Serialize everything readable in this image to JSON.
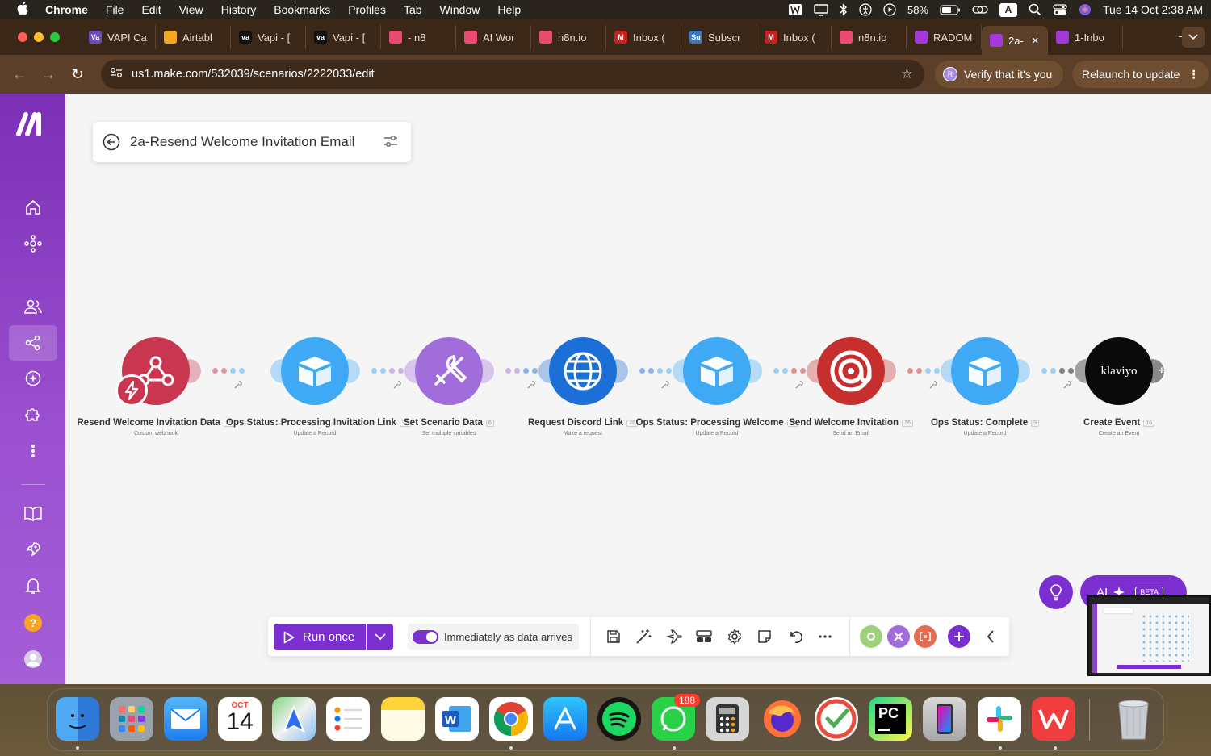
{
  "menubar": {
    "app": "Chrome",
    "items": [
      "File",
      "Edit",
      "View",
      "History",
      "Bookmarks",
      "Profiles",
      "Tab",
      "Window",
      "Help"
    ],
    "battery": "58%",
    "input_source": "A",
    "clock": "Tue 14 Oct  2:38 AM"
  },
  "tabs": [
    {
      "label": "VAPI Ca",
      "fav": "Va",
      "color": "#6b4ab6"
    },
    {
      "label": "Airtabl",
      "fav": "",
      "color": "#f5a623"
    },
    {
      "label": "Vapi - [",
      "fav": "va",
      "color": "#111111"
    },
    {
      "label": "Vapi - [",
      "fav": "va",
      "color": "#111111"
    },
    {
      "label": "- n8",
      "fav": "",
      "color": "#ea4b71"
    },
    {
      "label": "AI Wor",
      "fav": "",
      "color": "#ea4b71"
    },
    {
      "label": "n8n.io",
      "fav": "",
      "color": "#ea4b71"
    },
    {
      "label": "Inbox (",
      "fav": "M",
      "color": "#c5221f"
    },
    {
      "label": "Subscr",
      "fav": "Su",
      "color": "#3b78c4"
    },
    {
      "label": "Inbox (",
      "fav": "M",
      "color": "#c5221f"
    },
    {
      "label": "n8n.io",
      "fav": "",
      "color": "#ea4b71"
    },
    {
      "label": "RADOM",
      "fav": "",
      "color": "#a13ad8"
    },
    {
      "label": "2a-",
      "fav": "",
      "color": "#a13ad8",
      "active": true
    },
    {
      "label": "1-Inbo",
      "fav": "",
      "color": "#a13ad8"
    }
  ],
  "address": {
    "url": "us1.make.com/532039/scenarios/2222033/edit",
    "verify": "Verify that it's you",
    "relaunch": "Relaunch to update"
  },
  "scenario": {
    "title": "2a-Resend Welcome Invitation Email"
  },
  "modules": [
    {
      "name": "Resend Welcome Invitation Data",
      "badge": "25",
      "sub": "Custom webhook",
      "color": "#c8374f",
      "icon": "webhook-icon"
    },
    {
      "name": "Ops Status: Processing Invitation Link",
      "badge": "22",
      "sub": "Update a Record",
      "color": "#3fa9f5",
      "icon": "airtable-box-icon"
    },
    {
      "name": "Set Scenario Data",
      "badge": "6",
      "sub": "Set multiple variables",
      "color": "#a06ddb",
      "icon": "tools-icon"
    },
    {
      "name": "Request Discord Link",
      "badge": "28",
      "sub": "Make a request",
      "color": "#1d6fd8",
      "icon": "globe-icon"
    },
    {
      "name": "Ops Status: Processing Welcome",
      "badge": "23",
      "sub": "Update a Record",
      "color": "#3fa9f5",
      "icon": "airtable-box-icon"
    },
    {
      "name": "Send Welcome Invitation",
      "badge": "26",
      "sub": "Send an Email",
      "color": "#c72e2e",
      "icon": "at-icon"
    },
    {
      "name": "Ops Status: Complete",
      "badge": "9",
      "sub": "Update a Record",
      "color": "#3fa9f5",
      "icon": "airtable-box-icon"
    },
    {
      "name": "Create Event",
      "badge": "16",
      "sub": "Create an Event",
      "color": "#0a0a0a",
      "icon": "klaviyo-icon",
      "logo": "klaviyo"
    }
  ],
  "toolbar": {
    "run_label": "Run once",
    "schedule_label": "Immediately as data arrives"
  },
  "ai": {
    "label": "AI",
    "beta": "BETA"
  },
  "dock": {
    "calendar_month": "OCT",
    "calendar_day": "14",
    "whatsapp_badge": "188"
  }
}
